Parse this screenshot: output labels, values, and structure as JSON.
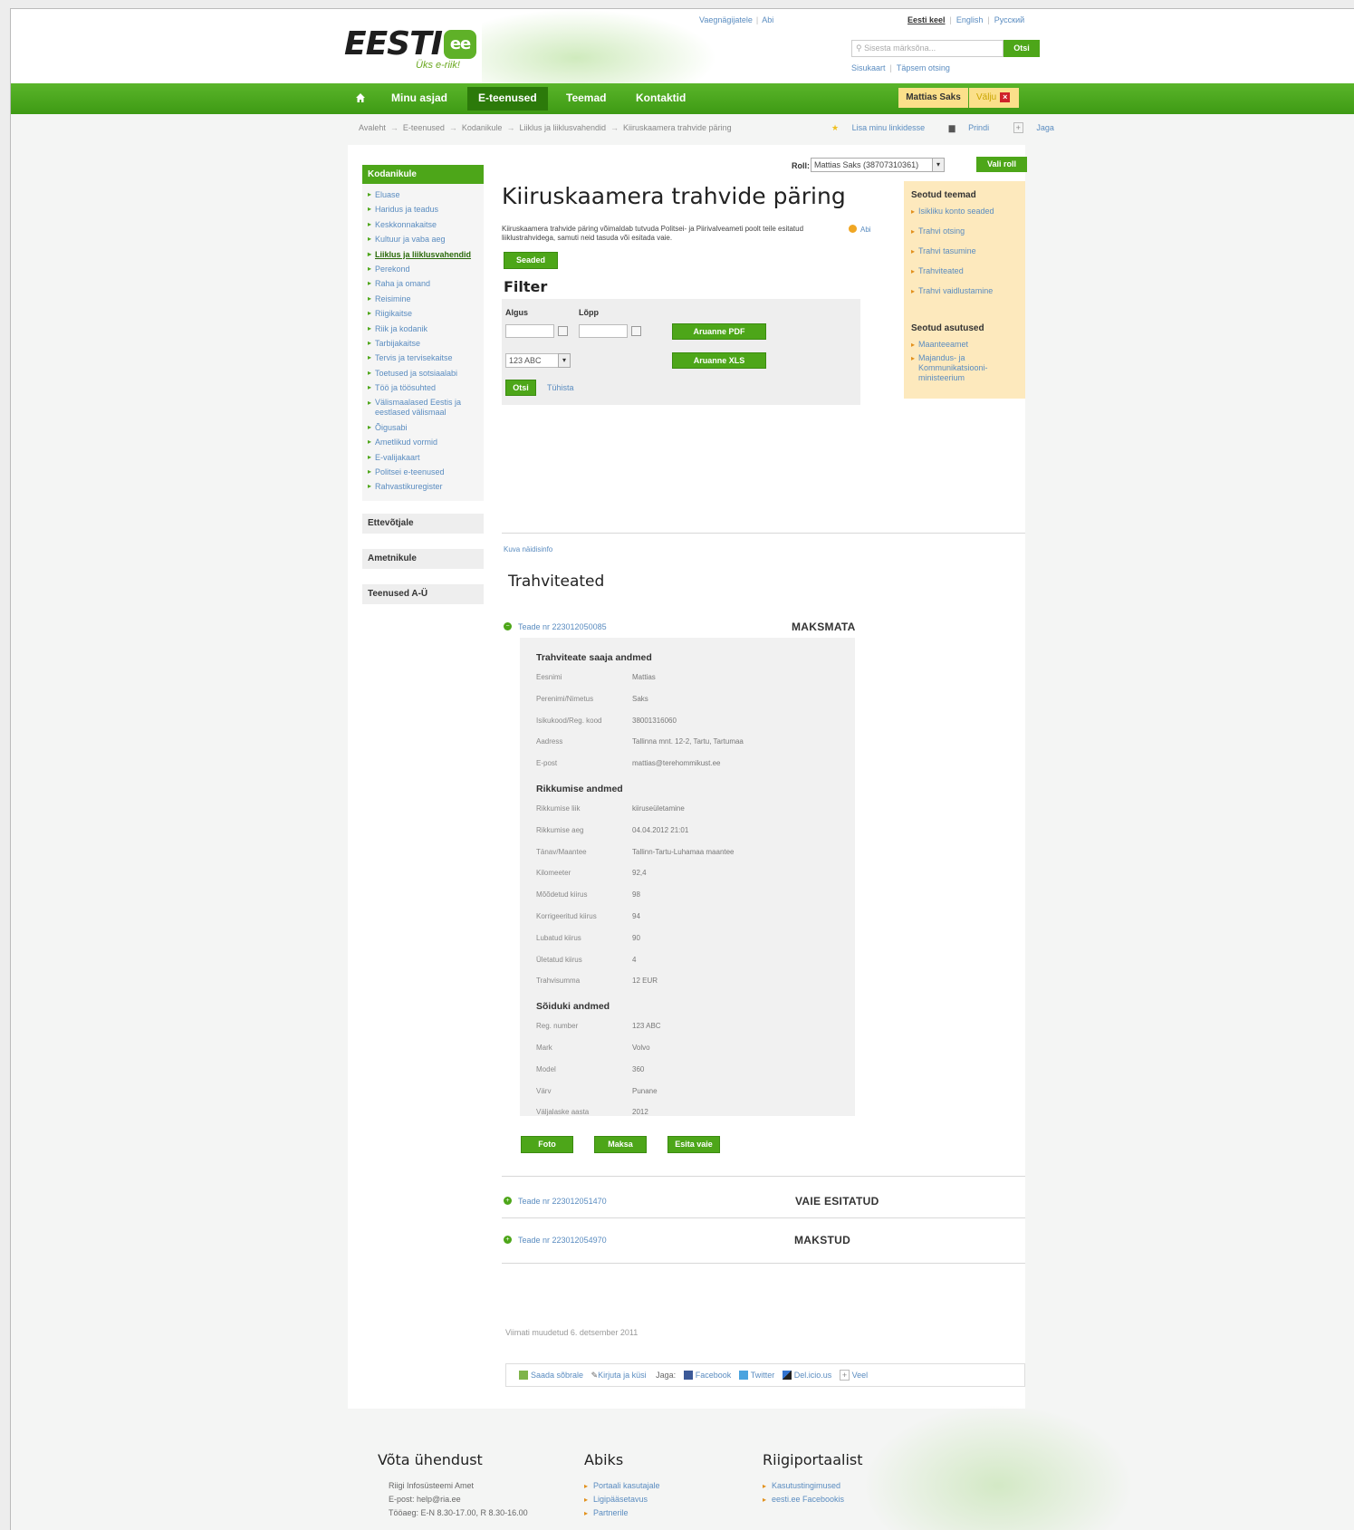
{
  "header": {
    "logo_text": "EESTI",
    "logo_badge": "ee",
    "tagline": "Üks e-riik!",
    "top_links": [
      "Vaegnägijatele",
      "Abi"
    ],
    "languages": [
      "Eesti keel",
      "English",
      "Русский"
    ],
    "search_placeholder": "Sisesta märksõna...",
    "search_button": "Otsi",
    "sub_links": [
      "Sisukaart",
      "Täpsem otsing"
    ]
  },
  "nav": {
    "items": [
      "Minu asjad",
      "E-teenused",
      "Teemad",
      "Kontaktid"
    ],
    "user": "Mattias Saks",
    "logout": "Välju"
  },
  "breadcrumb": {
    "items": [
      "Avaleht",
      "E-teenused",
      "Kodanikule",
      "Liiklus ja liiklusvahendid",
      "Kiiruskaamera trahvide päring"
    ],
    "actions": [
      "Lisa minu linkidesse",
      "Prindi",
      "Jaga"
    ]
  },
  "left_menu": {
    "header": "Kodanikule",
    "items": [
      "Eluase",
      "Haridus ja teadus",
      "Keskkonnakaitse",
      "Kultuur ja vaba aeg",
      "Liiklus ja liiklusvahendid",
      "Perekond",
      "Raha ja omand",
      "Reisimine",
      "Riigikaitse",
      "Riik ja kodanik",
      "Tarbijakaitse",
      "Tervis ja tervisekaitse",
      "Toetused ja sotsiaalabi",
      "Töö ja töösuhted",
      "Välismaalased Eestis ja eestlased välismaal",
      "Õigusabi",
      "Ametlikud vormid",
      "E-valijakaart",
      "Politsei e-teenused",
      "Rahvastikuregister"
    ],
    "sections": [
      "Ettevõtjale",
      "Ametnikule",
      "Teenused A-Ü"
    ]
  },
  "role": {
    "label": "Roll:",
    "value": "Mattias Saks (38707310361)",
    "button": "Vali roll"
  },
  "page": {
    "title": "Kiiruskaamera trahvide päring",
    "description": "Kiiruskaamera trahvide päring võimaldab tutvuda Politsei- ja Piirivalveameti poolt teile esitatud liiklustrahvidega, samuti neid tasuda või esitada vaie.",
    "help": "Abi",
    "settings_button": "Seaded"
  },
  "filter": {
    "title": "Filter",
    "start_label": "Algus",
    "end_label": "Lõpp",
    "plate_value": "123 ABC",
    "pdf_button": "Aruanne PDF",
    "xls_button": "Aruanne XLS",
    "search_button": "Otsi",
    "cancel_link": "Tühista"
  },
  "related": {
    "topics_title": "Seotud teemad",
    "topics": [
      "Isikliku konto seaded",
      "Trahvi otsing",
      "Trahvi tasumine",
      "Trahviteated",
      "Trahvi vaidlustamine"
    ],
    "agencies_title": "Seotud asutused",
    "agencies": [
      "Maanteeamet",
      "Majandus- ja Kommunikatsiooni-ministeerium"
    ]
  },
  "notices": {
    "demo_link": "Kuva näidisinfo",
    "title": "Trahviteated",
    "items": [
      {
        "id": "Teade nr 223012050085",
        "status": "MAKSMATA"
      },
      {
        "id": "Teade nr 223012051470",
        "status": "VAIE ESITATUD"
      },
      {
        "id": "Teade nr 223012054970",
        "status": "MAKSTUD"
      }
    ]
  },
  "details": {
    "recipient_title": "Trahviteate saaja andmed",
    "recipient": [
      {
        "k": "Eesnimi",
        "v": "Mattias"
      },
      {
        "k": "Perenimi/Nimetus",
        "v": "Saks"
      },
      {
        "k": "Isikukood/Reg. kood",
        "v": "38001316060"
      },
      {
        "k": "Aadress",
        "v": "Tallinna mnt. 12-2, Tartu, Tartumaa"
      },
      {
        "k": "E-post",
        "v": "mattias@terehommikust.ee"
      }
    ],
    "violation_title": "Rikkumise andmed",
    "violation": [
      {
        "k": "Rikkumise liik",
        "v": "kiiruseületamine"
      },
      {
        "k": "Rikkumise aeg",
        "v": "04.04.2012    21:01"
      },
      {
        "k": "Tänav/Maantee",
        "v": "Tallinn-Tartu-Luhamaa maantee"
      },
      {
        "k": "Kilomeeter",
        "v": "92,4"
      },
      {
        "k": "Mõõdetud kiirus",
        "v": "98"
      },
      {
        "k": "Korrigeeritud kiirus",
        "v": "94"
      },
      {
        "k": "Lubatud kiirus",
        "v": "90"
      },
      {
        "k": "Ületatud kiirus",
        "v": "4"
      },
      {
        "k": "Trahvisumma",
        "v": "12 EUR"
      }
    ],
    "vehicle_title": "Sõiduki andmed",
    "vehicle": [
      {
        "k": "Reg. number",
        "v": "123 ABC"
      },
      {
        "k": "Mark",
        "v": "Volvo"
      },
      {
        "k": "Model",
        "v": "360"
      },
      {
        "k": "Värv",
        "v": "Punane"
      },
      {
        "k": "Väljalaske aasta",
        "v": "2012"
      }
    ],
    "buttons": [
      "Foto",
      "Maksa",
      "Esita vaie"
    ]
  },
  "footer_panel": {
    "last_modified": "Viimati muudetud 6. detsember 2011",
    "shares": [
      "Saada sõbrale",
      "Kirjuta ja küsi",
      "Jaga:",
      "Facebook",
      "Twitter",
      "Del.icio.us",
      "Veel"
    ]
  },
  "footer": {
    "contact_title": "Võta ühendust",
    "contact_lines": [
      "Riigi Infosüsteemi Amet",
      "E-post: help@ria.ee",
      "Tööaeg: E-N 8.30-17.00, R 8.30-16.00"
    ],
    "help_title": "Abiks",
    "help_links": [
      "Portaali kasutajale",
      "Ligipääsetavus",
      "Partnerile"
    ],
    "portal_title": "Riigiportaalist",
    "portal_links": [
      "Kasutustingimused",
      "eesti.ee Facebookis"
    ]
  },
  "colors": {
    "brand_green": "#4da619",
    "link_blue": "#5a8cc0",
    "related_bg": "#fde9bd"
  }
}
